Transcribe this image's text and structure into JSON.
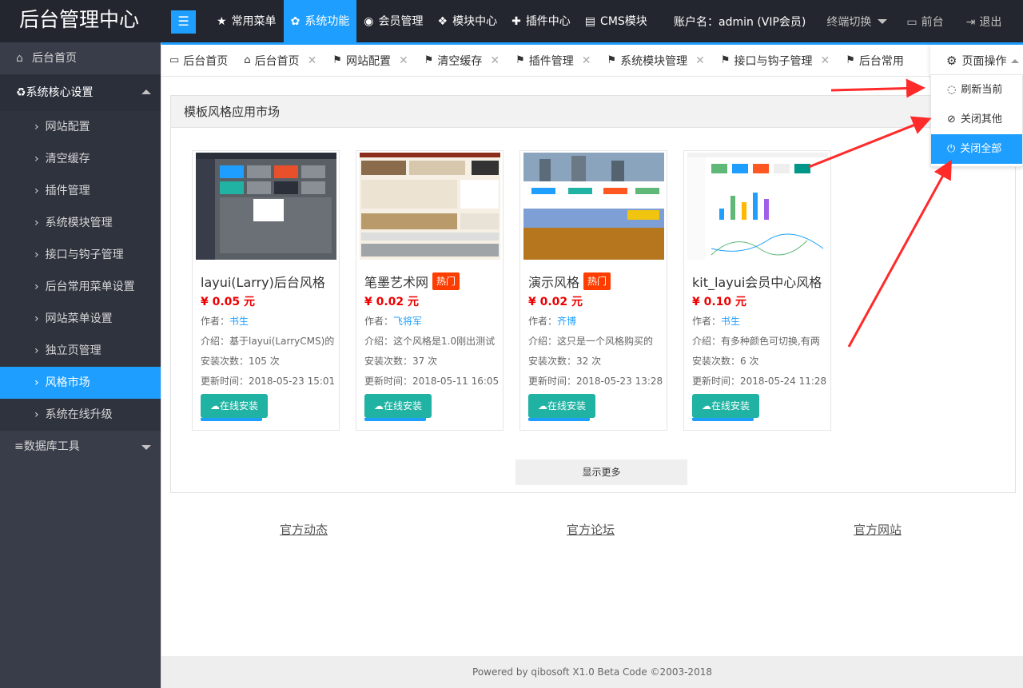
{
  "app_title": "后台管理中心",
  "topnav": [
    {
      "icon": "star-icon",
      "label": "常用菜单",
      "active": false
    },
    {
      "icon": "gear-icon",
      "label": "系统功能",
      "active": true
    },
    {
      "icon": "user-icon",
      "label": "会员管理",
      "active": false
    },
    {
      "icon": "cubes-icon",
      "label": "模块中心",
      "active": false
    },
    {
      "icon": "puzzle-icon",
      "label": "插件中心",
      "active": false
    },
    {
      "icon": "file-icon",
      "label": "CMS模块",
      "active": false
    }
  ],
  "userbar": {
    "account": "账户名：admin (VIP会员)",
    "terminal_switch": "终端切换",
    "front": "前台",
    "logout": "退出"
  },
  "sidebar": {
    "home": "后台首页",
    "core_group": "系统核心设置",
    "core_items": [
      "网站配置",
      "清空缓存",
      "插件管理",
      "系统模块管理",
      "接口与钩子管理",
      "后台常用菜单设置",
      "网站菜单设置",
      "独立页管理",
      "风格市场",
      "系统在线升级"
    ],
    "active_item": "风格市场",
    "db_group": "数据库工具"
  },
  "tabs": [
    {
      "label": "后台首页",
      "closable": false,
      "icon": "monitor-icon"
    },
    {
      "label": "后台首页",
      "closable": true,
      "icon": "home-icon"
    },
    {
      "label": "网站配置",
      "closable": true,
      "icon": "flag-icon"
    },
    {
      "label": "清空缓存",
      "closable": true,
      "icon": "flag-icon"
    },
    {
      "label": "插件管理",
      "closable": true,
      "icon": "flag-icon"
    },
    {
      "label": "系统模块管理",
      "closable": true,
      "icon": "flag-icon"
    },
    {
      "label": "接口与钩子管理",
      "closable": true,
      "icon": "flag-icon"
    },
    {
      "label": "后台常用",
      "closable": false,
      "icon": "flag-icon"
    }
  ],
  "page_ops": {
    "label": "页面操作",
    "items": [
      {
        "label": "刷新当前",
        "icon": "refresh-icon",
        "active": false
      },
      {
        "label": "关闭其他",
        "icon": "ban-icon",
        "active": false
      },
      {
        "label": "关闭全部",
        "icon": "power-icon",
        "active": true
      }
    ]
  },
  "market": {
    "title": "模板风格应用市场",
    "author_prefix": "作者：",
    "intro_prefix": "介绍：",
    "install_prefix": "安装次数：",
    "update_prefix": "更新时间：",
    "install_label": "在线安装",
    "hot_label": "热门",
    "more_label": "显示更多",
    "cards": [
      {
        "title": "layui(Larry)后台风格",
        "hot": false,
        "price": "¥ 0.05 元",
        "author": "书生",
        "intro": "基于layui(LarryCMS)的",
        "installs": "105 次",
        "updated": "2018-05-23 15:01"
      },
      {
        "title": "笔墨艺术网",
        "hot": true,
        "price": "¥ 0.02 元",
        "author": "飞将军",
        "intro": "这个风格是1.0刚出测试",
        "installs": "37 次",
        "updated": "2018-05-11 16:05"
      },
      {
        "title": "演示风格",
        "hot": true,
        "price": "¥ 0.02 元",
        "author": "齐博",
        "intro": "这只是一个风格购买的",
        "installs": "32 次",
        "updated": "2018-05-23 13:28"
      },
      {
        "title": "kit_layui会员中心风格",
        "hot": false,
        "price": "¥ 0.10 元",
        "author": "书生",
        "intro": "有多种颜色可切换,有两",
        "installs": "6 次",
        "updated": "2018-05-24 11:28"
      }
    ]
  },
  "links": [
    "官方动态",
    "官方论坛",
    "官方网站"
  ],
  "footer": "Powered by  qibosoft X1.0 Beta Code ©2003-2018",
  "colors": {
    "accent": "#1e9fff",
    "topbar": "#23262e",
    "sidebar": "#393d49",
    "install": "#20b2a2",
    "hot": "#ff3d00",
    "price": "#ee0000",
    "annotation_arrow": "#ff2a2a"
  }
}
